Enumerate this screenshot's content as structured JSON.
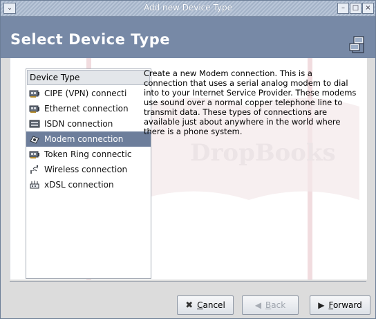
{
  "window": {
    "title": "Add new Device Type",
    "controls": {
      "minimize": "–",
      "maximize": "□",
      "close": "×",
      "menu": "⌄"
    }
  },
  "header": {
    "title": "Select Device Type",
    "icon": "network-computers-icon"
  },
  "device_list": {
    "header": "Device Type",
    "items": [
      {
        "label": "CIPE (VPN) connecti",
        "icon": "network-card-icon",
        "selected": false
      },
      {
        "label": "Ethernet connection",
        "icon": "network-card-icon",
        "selected": false
      },
      {
        "label": "ISDN connection",
        "icon": "isdn-card-icon",
        "selected": false
      },
      {
        "label": "Modem connection",
        "icon": "modem-icon",
        "selected": true
      },
      {
        "label": "Token Ring connectic",
        "icon": "network-card-icon",
        "selected": false
      },
      {
        "label": "Wireless connection",
        "icon": "wireless-icon",
        "selected": false
      },
      {
        "label": "xDSL connection",
        "icon": "xdsl-icon",
        "selected": false
      }
    ]
  },
  "description": "Create a new Modem connection.  This is a connection that uses a serial analog modem to dial into to your Internet Service Provider. These modems use sound over a normal copper telephone line to transmit data.  These types of connections are available just about anywhere in the world where there is a phone system.",
  "buttons": {
    "cancel": {
      "mnemonic": "C",
      "rest": "ancel",
      "enabled": true
    },
    "back": {
      "mnemonic": "B",
      "rest": "ack",
      "enabled": false
    },
    "forward": {
      "mnemonic": "F",
      "rest": "orward",
      "enabled": true
    }
  },
  "watermark": {
    "text": "DropBooks"
  },
  "colors": {
    "banner": "#7789a6",
    "selection": "#6d7e9b"
  }
}
